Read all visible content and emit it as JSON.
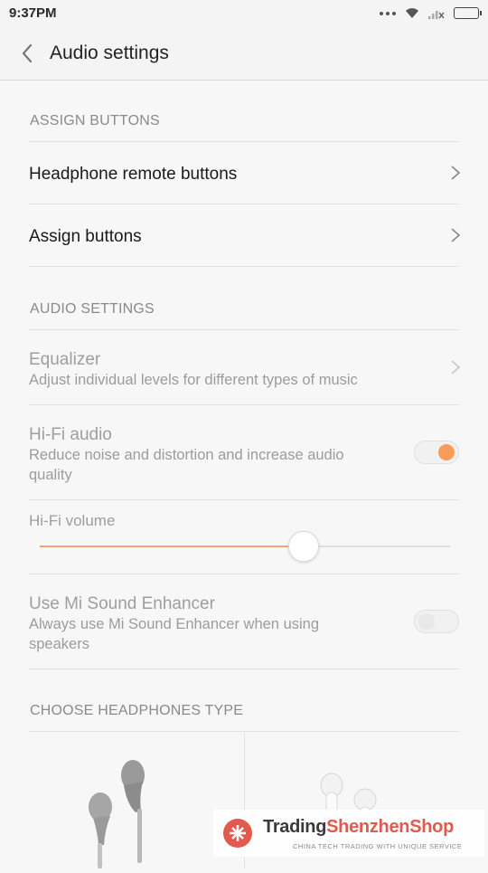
{
  "status_bar": {
    "time": "9:37PM"
  },
  "app_bar": {
    "title": "Audio settings"
  },
  "sections": {
    "assign_buttons": "ASSIGN BUTTONS",
    "audio_settings": "AUDIO SETTINGS",
    "choose_headphones": "CHOOSE HEADPHONES TYPE"
  },
  "items": {
    "headphone_remote": {
      "title": "Headphone remote buttons"
    },
    "assign_buttons": {
      "title": "Assign buttons"
    },
    "equalizer": {
      "title": "Equalizer",
      "subtitle": "Adjust individual levels for different types of music"
    },
    "hifi_audio": {
      "title": "Hi-Fi audio",
      "subtitle": "Reduce noise and distortion and increase audio quality",
      "enabled": true
    },
    "hifi_volume": {
      "title": "Hi-Fi volume",
      "level": 0.64
    },
    "mi_sound": {
      "title": "Use Mi Sound Enhancer",
      "subtitle": "Always use Mi Sound Enhancer when using speakers",
      "enabled": false
    }
  },
  "headphone_types": [
    "earbuds-icon",
    "in-ear-icon"
  ],
  "watermark": {
    "brand_part1": "Trading",
    "brand_part2": "ShenzhenShop",
    "tagline": "CHINA TECH TRADING WITH UNIQUE SERVICE"
  },
  "colors": {
    "accent": "#f79d5b",
    "slider": "#f4a47a",
    "brand_red": "#e25a4d"
  }
}
